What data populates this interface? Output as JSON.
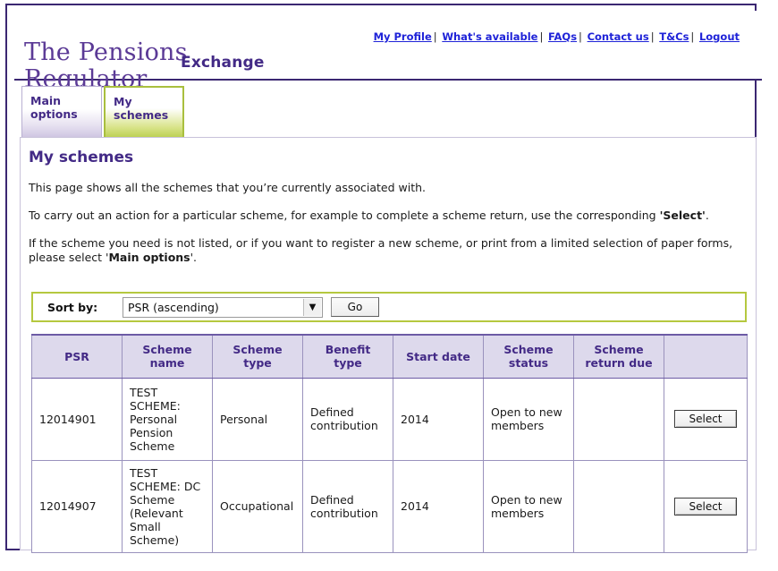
{
  "brand": {
    "logo_line1": "The Pensions",
    "logo_line2": "Regulator",
    "product": "Exchange"
  },
  "topnav": {
    "items": [
      {
        "label": "My Profile"
      },
      {
        "label": "What's available"
      },
      {
        "label": "FAQs"
      },
      {
        "label": "Contact us"
      },
      {
        "label": "T&Cs"
      },
      {
        "label": "Logout"
      }
    ],
    "separator": "|"
  },
  "tabs": [
    {
      "line1": "Main",
      "line2": "options",
      "active": false
    },
    {
      "line1": "My",
      "line2": "schemes",
      "active": true
    }
  ],
  "page": {
    "title": "My schemes",
    "paragraph1": "This page shows all the schemes that you’re currently associated with.",
    "paragraph2_before": "To carry out an action for a particular scheme, for example to complete a scheme return, use the corresponding ",
    "paragraph2_bold": "'Select'",
    "paragraph2_after": ".",
    "paragraph3_before": "If the scheme you need is not listed, or if you want to register a new scheme, or print from a limited selection of paper forms, please select '",
    "paragraph3_bold": "Main options",
    "paragraph3_after": "'."
  },
  "sort": {
    "label": "Sort by:",
    "selected": "PSR (ascending)",
    "options": [
      "PSR (ascending)"
    ],
    "arrow_icon": "chevron-down-icon",
    "go_label": "Go"
  },
  "table": {
    "columns": [
      "PSR",
      "Scheme name",
      "Scheme type",
      "Benefit type",
      "Start date",
      "Scheme status",
      "Scheme return due",
      ""
    ],
    "rows": [
      {
        "psr": "12014901",
        "scheme_name": "TEST SCHEME: Personal Pension Scheme",
        "scheme_type": "Personal",
        "benefit_type": "Defined contribution",
        "start_date": "2014",
        "scheme_status": "Open to new members",
        "scheme_return_due": "",
        "action_label": "Select"
      },
      {
        "psr": "12014907",
        "scheme_name": "TEST SCHEME: DC Scheme (Relevant Small Scheme)",
        "scheme_type": "Occupational",
        "benefit_type": "Defined contribution",
        "start_date": "2014",
        "scheme_status": "Open to new members",
        "scheme_return_due": "",
        "action_label": "Select"
      }
    ]
  },
  "colors": {
    "brand_purple": "#432a86",
    "logo_purple": "#5b3a96",
    "link_blue": "#1f23d8",
    "tab_active_green": "#a9bf3e",
    "header_lavender": "#ddd9ec",
    "sortbar_olive": "#b5c83f"
  }
}
